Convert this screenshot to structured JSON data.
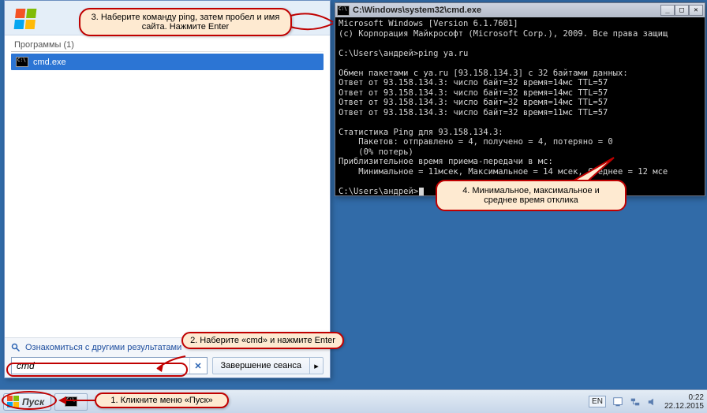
{
  "taskbar": {
    "start_label": "Пуск",
    "tray": {
      "lang": "EN",
      "time": "0:22",
      "date": "22.12.2015"
    }
  },
  "start_menu": {
    "group_label": "Программы (1)",
    "result_name": "cmd.exe",
    "more_results": "Ознакомиться с другими результатами",
    "search_value": "cmd",
    "power_label": "Завершение сеанса"
  },
  "cmd_window": {
    "title": "C:\\Windows\\system32\\cmd.exe",
    "lines": [
      "Microsoft Windows [Version 6.1.7601]",
      "(c) Корпорация Майкрософт (Microsoft Corp.), 2009. Все права защищ",
      "",
      "C:\\Users\\андрей>ping ya.ru",
      "",
      "Обмен пакетами с ya.ru [93.158.134.3] с 32 байтами данных:",
      "Ответ от 93.158.134.3: число байт=32 время=14мс TTL=57",
      "Ответ от 93.158.134.3: число байт=32 время=14мс TTL=57",
      "Ответ от 93.158.134.3: число байт=32 время=14мс TTL=57",
      "Ответ от 93.158.134.3: число байт=32 время=11мс TTL=57",
      "",
      "Статистика Ping для 93.158.134.3:",
      "    Пакетов: отправлено = 4, получено = 4, потеряно = 0",
      "    (0% потерь)",
      "Приблизительное время приема-передачи в мс:",
      "    Минимальное = 11мсек, Максимальное = 14 мсек, Среднее = 12 мсе",
      "",
      "C:\\Users\\андрей>"
    ]
  },
  "callouts": {
    "c1": "1. Кликните меню «Пуск»",
    "c2": "2. Наберите «cmd» и нажмите Enter",
    "c3": "3. Наберите команду ping, затем пробел и имя сайта. Нажмите Enter",
    "c4": "4. Минимальное, максимальное и среднее время отклика"
  }
}
